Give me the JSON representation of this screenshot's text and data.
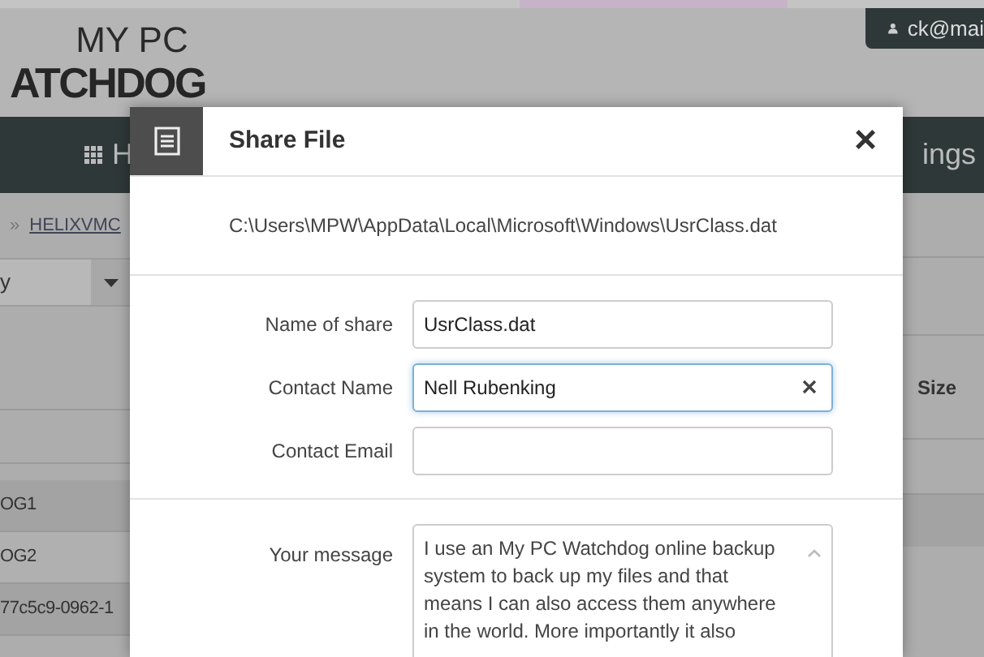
{
  "header": {
    "logo_top": "MY PC",
    "logo_bottom": "ATCHDOG",
    "user": "ck@mai"
  },
  "nav": {
    "left_item": "H",
    "right_item": "ings"
  },
  "breadcrumb": {
    "separator": "»",
    "link": "HELIXVMC"
  },
  "filter": {
    "value": "y"
  },
  "table": {
    "size_header": "Size",
    "rows": [
      {
        "name": "OG1",
        "selected": true
      },
      {
        "name": "OG2",
        "selected": false
      },
      {
        "name": "77c5c9-0962-1",
        "selected": true
      }
    ]
  },
  "dialog": {
    "title": "Share File",
    "close": "×",
    "path": "C:\\Users\\MPW\\AppData\\Local\\Microsoft\\Windows\\UsrClass.dat",
    "fields": [
      {
        "label": "Name of share",
        "value": "UsrClass.dat",
        "focused": false,
        "clearable": false
      },
      {
        "label": "Contact Name",
        "value": "Nell Rubenking",
        "focused": true,
        "clearable": true
      },
      {
        "label": "Contact Email",
        "focused": false,
        "clearable": false
      }
    ],
    "message": {
      "label": "Your message",
      "value": "I use an My PC Watchdog online backup system to back up my files and that means I can also access them anywhere in the world. More importantly it also"
    }
  }
}
